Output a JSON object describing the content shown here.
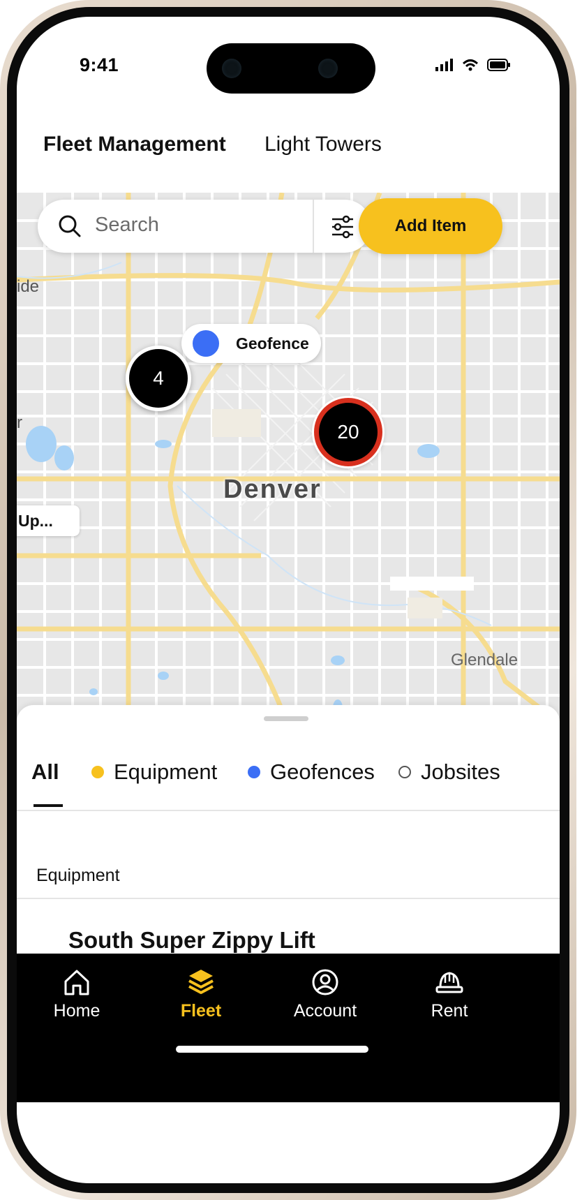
{
  "status_bar": {
    "time": "9:41"
  },
  "tabs": [
    {
      "label": "Fleet Management",
      "active": true
    },
    {
      "label": "Light Towers",
      "active": false
    }
  ],
  "map": {
    "search_placeholder": "Search",
    "add_button_label": "Add Item",
    "geofence_marker_label": "Geofence",
    "city_label": "Denver",
    "edge_labels": {
      "left_top": "ide",
      "left_mid": "r",
      "left_tag": "Up...",
      "right_bottom": "Glendale"
    },
    "clusters": [
      {
        "count": "4",
        "style": "plain"
      },
      {
        "count": "20",
        "style": "alert"
      }
    ],
    "colors": {
      "land": "#e7e7e7",
      "roads": "#ffffff",
      "highways": "#f6dc8f",
      "water": "#a8d2f6",
      "geofence": "#3b6ef5",
      "alert": "#d8301e"
    }
  },
  "sheet": {
    "filters": [
      {
        "label": "All",
        "dot": null,
        "active": true
      },
      {
        "label": "Equipment",
        "dot": "#f7c11e",
        "active": false
      },
      {
        "label": "Geofences",
        "dot": "#3b6ef5",
        "active": false
      },
      {
        "label": "Jobsites",
        "dot": "outline",
        "active": false
      }
    ],
    "section_title": "Equipment",
    "items": [
      {
        "title": "South Super Zippy Lift"
      }
    ]
  },
  "bottom_nav": [
    {
      "label": "Home",
      "icon": "home-icon",
      "active": false
    },
    {
      "label": "Fleet",
      "icon": "layers-icon",
      "active": true
    },
    {
      "label": "Account",
      "icon": "account-icon",
      "active": false
    },
    {
      "label": "Rent",
      "icon": "hardhat-icon",
      "active": false
    }
  ],
  "accent_color": "#f7c11e"
}
